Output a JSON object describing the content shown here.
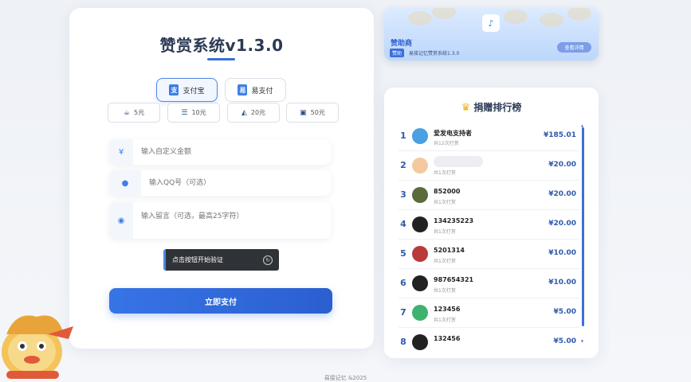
{
  "main": {
    "title": "赞赏系统v1.3.0",
    "pay_methods": [
      {
        "label": "支付宝",
        "icon": "alipay-icon",
        "active": true
      },
      {
        "label": "易支付",
        "icon": "epay-icon",
        "active": false
      }
    ],
    "amounts": [
      {
        "label": "5元",
        "icon": "coffee-icon"
      },
      {
        "label": "10元",
        "icon": "burger-icon"
      },
      {
        "label": "20元",
        "icon": "pizza-icon"
      },
      {
        "label": "50元",
        "icon": "gift-icon"
      }
    ],
    "amount_placeholder": "输入自定义金额",
    "qq_placeholder": "输入QQ号（可选）",
    "message_placeholder": "输入留言（可选，最高25字符）",
    "captcha_label": "点击按钮开始验证",
    "pay_button": "立即支付",
    "currency_symbol": "¥"
  },
  "banner": {
    "title": "赞助商",
    "tag": "赞助",
    "desc": "易接记忆赞赏系统1.3.0",
    "button": "查看详情"
  },
  "rank": {
    "title": "捐赠排行榜",
    "rows": [
      {
        "no": "1",
        "name": "爱发电支持者",
        "count": "共12次打赏",
        "amount": "¥185.01",
        "avatar_color": "#4aa0e0"
      },
      {
        "no": "2",
        "name": "",
        "count": "共1次打赏",
        "amount": "¥20.00",
        "avatar_color": "#f5c9a0"
      },
      {
        "no": "3",
        "name": "852000",
        "count": "共1次打赏",
        "amount": "¥20.00",
        "avatar_color": "#5a6b3c"
      },
      {
        "no": "4",
        "name": "134235223",
        "count": "共1次打赏",
        "amount": "¥20.00",
        "avatar_color": "#222222"
      },
      {
        "no": "5",
        "name": "5201314",
        "count": "共1次打赏",
        "amount": "¥10.00",
        "avatar_color": "#b83a3a"
      },
      {
        "no": "6",
        "name": "987654321",
        "count": "共1次打赏",
        "amount": "¥10.00",
        "avatar_color": "#222222"
      },
      {
        "no": "7",
        "name": "123456",
        "count": "共1次打赏",
        "amount": "¥5.00",
        "avatar_color": "#3fb26e"
      },
      {
        "no": "8",
        "name": "132456",
        "count": "",
        "amount": "¥5.00",
        "avatar_color": "#222222"
      }
    ]
  },
  "footer": "易接记忆 &2025",
  "colors": {
    "accent": "#3774e6",
    "rank_text": "#2e5aa8"
  }
}
